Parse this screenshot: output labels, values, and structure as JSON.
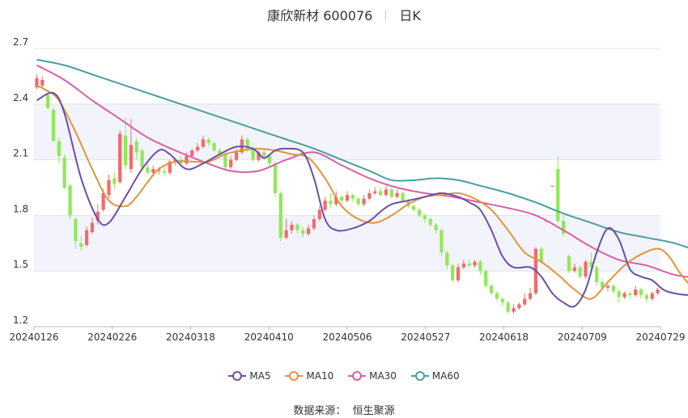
{
  "title": "康欣新材 600076",
  "period": "日K",
  "source_label": "数据来源：",
  "source_name": "恒生聚源",
  "colors": {
    "up": "#f06b6b",
    "down": "#90e85a",
    "ma5": "#6a4fa8",
    "ma10": "#e0953b",
    "ma30": "#d95ea8",
    "ma60": "#4a9e9e"
  },
  "chart_data": {
    "type": "candlestick",
    "ylim": [
      1.2,
      2.7
    ],
    "yticks": [
      1.2,
      1.5,
      1.8,
      2.1,
      2.4,
      2.7
    ],
    "xticks": [
      "20240126",
      "20240226",
      "20240318",
      "20240410",
      "20240506",
      "20240527",
      "20240618",
      "20240709",
      "20240729"
    ],
    "legend": [
      {
        "name": "MA5",
        "color_key": "ma5"
      },
      {
        "name": "MA10",
        "color_key": "ma10"
      },
      {
        "name": "MA30",
        "color_key": "ma30"
      },
      {
        "name": "MA60",
        "color_key": "ma60"
      }
    ],
    "candles": [
      [
        2.49,
        2.54,
        2.48,
        2.56
      ],
      [
        2.5,
        2.53,
        2.49,
        2.55
      ],
      [
        2.45,
        2.38,
        2.37,
        2.46
      ],
      [
        2.37,
        2.2,
        2.2,
        2.38
      ],
      [
        2.2,
        2.12,
        2.08,
        2.22
      ],
      [
        2.11,
        1.95,
        1.94,
        2.13
      ],
      [
        1.96,
        1.8,
        1.78,
        1.97
      ],
      [
        1.78,
        1.66,
        1.62,
        1.79
      ],
      [
        1.65,
        1.63,
        1.61,
        1.69
      ],
      [
        1.64,
        1.72,
        1.63,
        1.74
      ],
      [
        1.71,
        1.76,
        1.7,
        1.79
      ],
      [
        1.77,
        1.82,
        1.75,
        1.86
      ],
      [
        1.83,
        1.92,
        1.82,
        1.94
      ],
      [
        1.91,
        1.99,
        1.89,
        2.02
      ],
      [
        2.0,
        1.97,
        1.94,
        2.03
      ],
      [
        1.98,
        2.24,
        1.97,
        2.26
      ],
      [
        2.23,
        2.07,
        2.05,
        2.33
      ],
      [
        2.05,
        2.18,
        2.03,
        2.32
      ],
      [
        2.2,
        2.14,
        2.1,
        2.22
      ],
      [
        2.15,
        2.06,
        2.04,
        2.16
      ],
      [
        2.06,
        2.03,
        2.02,
        2.08
      ],
      [
        2.03,
        2.05,
        2.01,
        2.07
      ],
      [
        2.04,
        2.05,
        2.02,
        2.06
      ],
      [
        2.04,
        2.03,
        2.01,
        2.06
      ],
      [
        2.03,
        2.09,
        2.02,
        2.1
      ],
      [
        2.09,
        2.1,
        2.07,
        2.11
      ],
      [
        2.1,
        2.08,
        2.07,
        2.12
      ],
      [
        2.08,
        2.12,
        2.07,
        2.14
      ],
      [
        2.12,
        2.15,
        2.11,
        2.16
      ],
      [
        2.15,
        2.17,
        2.14,
        2.19
      ],
      [
        2.17,
        2.21,
        2.16,
        2.23
      ],
      [
        2.21,
        2.19,
        2.17,
        2.22
      ],
      [
        2.19,
        2.15,
        2.14,
        2.2
      ],
      [
        2.15,
        2.13,
        2.12,
        2.16
      ],
      [
        2.13,
        2.06,
        2.05,
        2.14
      ],
      [
        2.06,
        2.1,
        2.05,
        2.12
      ],
      [
        2.1,
        2.14,
        2.09,
        2.16
      ],
      [
        2.14,
        2.21,
        2.13,
        2.23
      ],
      [
        2.21,
        2.16,
        2.14,
        2.22
      ],
      [
        2.16,
        2.1,
        2.09,
        2.17
      ],
      [
        2.1,
        2.14,
        2.09,
        2.15
      ],
      [
        2.14,
        2.12,
        2.1,
        2.16
      ],
      [
        2.12,
        2.08,
        2.06,
        2.13
      ],
      [
        2.08,
        1.92,
        1.9,
        2.09
      ],
      [
        1.92,
        1.68,
        1.66,
        1.93
      ],
      [
        1.68,
        1.72,
        1.67,
        1.78
      ],
      [
        1.72,
        1.75,
        1.7,
        1.77
      ],
      [
        1.75,
        1.72,
        1.7,
        1.76
      ],
      [
        1.72,
        1.7,
        1.68,
        1.74
      ],
      [
        1.7,
        1.73,
        1.69,
        1.75
      ],
      [
        1.73,
        1.78,
        1.72,
        1.8
      ],
      [
        1.78,
        1.83,
        1.77,
        1.85
      ],
      [
        1.83,
        1.88,
        1.82,
        1.9
      ],
      [
        1.88,
        1.86,
        1.84,
        1.92
      ],
      [
        1.86,
        1.9,
        1.85,
        1.93
      ],
      [
        1.9,
        1.88,
        1.86,
        1.91
      ],
      [
        1.88,
        1.91,
        1.87,
        1.93
      ],
      [
        1.91,
        1.89,
        1.87,
        1.92
      ],
      [
        1.89,
        1.86,
        1.85,
        1.9
      ],
      [
        1.86,
        1.89,
        1.85,
        1.91
      ],
      [
        1.89,
        1.92,
        1.88,
        1.94
      ],
      [
        1.92,
        1.93,
        1.91,
        1.95
      ],
      [
        1.93,
        1.91,
        1.9,
        1.95
      ],
      [
        1.91,
        1.94,
        1.9,
        1.96
      ],
      [
        1.94,
        1.9,
        1.89,
        1.95
      ],
      [
        1.9,
        1.92,
        1.89,
        1.94
      ],
      [
        1.92,
        1.88,
        1.87,
        1.93
      ],
      [
        1.88,
        1.85,
        1.84,
        1.89
      ],
      [
        1.85,
        1.83,
        1.82,
        1.86
      ],
      [
        1.83,
        1.8,
        1.79,
        1.84
      ],
      [
        1.8,
        1.78,
        1.76,
        1.81
      ],
      [
        1.78,
        1.75,
        1.74,
        1.79
      ],
      [
        1.75,
        1.72,
        1.7,
        1.76
      ],
      [
        1.72,
        1.6,
        1.58,
        1.73
      ],
      [
        1.6,
        1.53,
        1.51,
        1.61
      ],
      [
        1.53,
        1.45,
        1.44,
        1.54
      ],
      [
        1.45,
        1.52,
        1.44,
        1.54
      ],
      [
        1.52,
        1.54,
        1.51,
        1.56
      ],
      [
        1.54,
        1.53,
        1.52,
        1.56
      ],
      [
        1.53,
        1.55,
        1.52,
        1.56
      ],
      [
        1.55,
        1.5,
        1.48,
        1.56
      ],
      [
        1.5,
        1.42,
        1.41,
        1.51
      ],
      [
        1.42,
        1.38,
        1.37,
        1.43
      ],
      [
        1.38,
        1.35,
        1.34,
        1.39
      ],
      [
        1.35,
        1.33,
        1.31,
        1.36
      ],
      [
        1.33,
        1.28,
        1.27,
        1.34
      ],
      [
        1.28,
        1.3,
        1.27,
        1.32
      ],
      [
        1.3,
        1.32,
        1.29,
        1.33
      ],
      [
        1.32,
        1.35,
        1.31,
        1.38
      ],
      [
        1.35,
        1.38,
        1.34,
        1.41
      ],
      [
        1.38,
        1.62,
        1.37,
        1.63
      ],
      [
        1.62,
        1.55,
        1.54,
        1.63
      ],
      [
        1.77,
        1.77,
        1.77,
        1.77
      ],
      [
        1.96,
        1.96,
        1.96,
        1.96
      ],
      [
        2.05,
        1.77,
        1.76,
        2.12
      ],
      [
        1.77,
        1.7,
        1.69,
        1.8
      ],
      [
        1.58,
        1.5,
        1.49,
        1.59
      ],
      [
        1.5,
        1.52,
        1.49,
        1.54
      ],
      [
        1.52,
        1.47,
        1.46,
        1.53
      ],
      [
        1.47,
        1.55,
        1.46,
        1.56
      ],
      [
        1.55,
        1.52,
        1.5,
        1.6
      ],
      [
        1.52,
        1.44,
        1.42,
        1.53
      ],
      [
        1.44,
        1.41,
        1.4,
        1.46
      ],
      [
        1.41,
        1.42,
        1.39,
        1.43
      ],
      [
        1.42,
        1.39,
        1.38,
        1.43
      ],
      [
        1.39,
        1.36,
        1.33,
        1.4
      ],
      [
        1.36,
        1.38,
        1.35,
        1.39
      ],
      [
        1.38,
        1.37,
        1.35,
        1.39
      ],
      [
        1.37,
        1.4,
        1.36,
        1.42
      ],
      [
        1.4,
        1.37,
        1.35,
        1.41
      ],
      [
        1.37,
        1.35,
        1.33,
        1.38
      ],
      [
        1.35,
        1.38,
        1.34,
        1.39
      ],
      [
        1.38,
        1.4,
        1.37,
        1.41
      ]
    ],
    "ma": {
      "ma5": [
        [
          0,
          2.42
        ],
        [
          3,
          2.46
        ],
        [
          5,
          2.35
        ],
        [
          8,
          2.0
        ],
        [
          11,
          1.78
        ],
        [
          13,
          1.76
        ],
        [
          16,
          1.9
        ],
        [
          19,
          2.05
        ],
        [
          22,
          2.15
        ],
        [
          24,
          2.13
        ],
        [
          27,
          2.05
        ],
        [
          30,
          2.08
        ],
        [
          33,
          2.13
        ],
        [
          36,
          2.17
        ],
        [
          39,
          2.16
        ],
        [
          41,
          2.11
        ],
        [
          43,
          2.15
        ],
        [
          45,
          2.16
        ],
        [
          48,
          2.14
        ],
        [
          50,
          2.0
        ],
        [
          52,
          1.78
        ],
        [
          54,
          1.72
        ],
        [
          57,
          1.73
        ],
        [
          60,
          1.77
        ],
        [
          62,
          1.82
        ],
        [
          64,
          1.86
        ],
        [
          67,
          1.88
        ],
        [
          70,
          1.9
        ],
        [
          73,
          1.92
        ],
        [
          76,
          1.9
        ],
        [
          78,
          1.87
        ],
        [
          80,
          1.83
        ],
        [
          82,
          1.72
        ],
        [
          84,
          1.58
        ],
        [
          86,
          1.52
        ],
        [
          89,
          1.52
        ],
        [
          91,
          1.47
        ],
        [
          93,
          1.38
        ],
        [
          95,
          1.33
        ],
        [
          97,
          1.31
        ],
        [
          99,
          1.4
        ],
        [
          101,
          1.6
        ],
        [
          103,
          1.73
        ],
        [
          105,
          1.67
        ],
        [
          107,
          1.51
        ],
        [
          109,
          1.47
        ],
        [
          111,
          1.45
        ],
        [
          113,
          1.4
        ],
        [
          115,
          1.38
        ],
        [
          118,
          1.37
        ],
        [
          120,
          1.38
        ]
      ],
      "ma10": [
        [
          0,
          2.5
        ],
        [
          2,
          2.47
        ],
        [
          4,
          2.42
        ],
        [
          7,
          2.25
        ],
        [
          10,
          2.05
        ],
        [
          13,
          1.88
        ],
        [
          16,
          1.85
        ],
        [
          18,
          1.9
        ],
        [
          20,
          1.98
        ],
        [
          22,
          2.05
        ],
        [
          25,
          2.09
        ],
        [
          28,
          2.09
        ],
        [
          31,
          2.09
        ],
        [
          34,
          2.13
        ],
        [
          37,
          2.15
        ],
        [
          40,
          2.16
        ],
        [
          43,
          2.15
        ],
        [
          46,
          2.13
        ],
        [
          49,
          2.11
        ],
        [
          52,
          2.0
        ],
        [
          55,
          1.85
        ],
        [
          58,
          1.78
        ],
        [
          61,
          1.76
        ],
        [
          64,
          1.8
        ],
        [
          67,
          1.86
        ],
        [
          70,
          1.9
        ],
        [
          73,
          1.91
        ],
        [
          76,
          1.92
        ],
        [
          79,
          1.89
        ],
        [
          82,
          1.83
        ],
        [
          85,
          1.72
        ],
        [
          88,
          1.6
        ],
        [
          91,
          1.55
        ],
        [
          94,
          1.48
        ],
        [
          97,
          1.4
        ],
        [
          100,
          1.35
        ],
        [
          103,
          1.44
        ],
        [
          106,
          1.53
        ],
        [
          109,
          1.59
        ],
        [
          112,
          1.62
        ],
        [
          114,
          1.58
        ],
        [
          116,
          1.49
        ],
        [
          118,
          1.42
        ],
        [
          120,
          1.38
        ]
      ],
      "ma30": [
        [
          0,
          2.61
        ],
        [
          5,
          2.53
        ],
        [
          10,
          2.42
        ],
        [
          15,
          2.32
        ],
        [
          20,
          2.22
        ],
        [
          25,
          2.15
        ],
        [
          30,
          2.09
        ],
        [
          35,
          2.04
        ],
        [
          40,
          2.04
        ],
        [
          45,
          2.1
        ],
        [
          50,
          2.14
        ],
        [
          55,
          2.07
        ],
        [
          60,
          2.0
        ],
        [
          65,
          1.95
        ],
        [
          70,
          1.92
        ],
        [
          75,
          1.9
        ],
        [
          80,
          1.87
        ],
        [
          85,
          1.84
        ],
        [
          90,
          1.8
        ],
        [
          95,
          1.72
        ],
        [
          100,
          1.63
        ],
        [
          105,
          1.56
        ],
        [
          110,
          1.53
        ],
        [
          115,
          1.48
        ],
        [
          120,
          1.46
        ]
      ],
      "ma60": [
        [
          0,
          2.64
        ],
        [
          5,
          2.61
        ],
        [
          10,
          2.56
        ],
        [
          15,
          2.51
        ],
        [
          20,
          2.46
        ],
        [
          25,
          2.41
        ],
        [
          30,
          2.36
        ],
        [
          35,
          2.31
        ],
        [
          40,
          2.26
        ],
        [
          45,
          2.21
        ],
        [
          50,
          2.16
        ],
        [
          55,
          2.1
        ],
        [
          60,
          2.04
        ],
        [
          64,
          1.99
        ],
        [
          68,
          1.99
        ],
        [
          72,
          2.0
        ],
        [
          76,
          1.99
        ],
        [
          80,
          1.96
        ],
        [
          85,
          1.92
        ],
        [
          90,
          1.87
        ],
        [
          95,
          1.81
        ],
        [
          100,
          1.76
        ],
        [
          105,
          1.71
        ],
        [
          110,
          1.68
        ],
        [
          115,
          1.65
        ],
        [
          120,
          1.6
        ]
      ]
    }
  }
}
